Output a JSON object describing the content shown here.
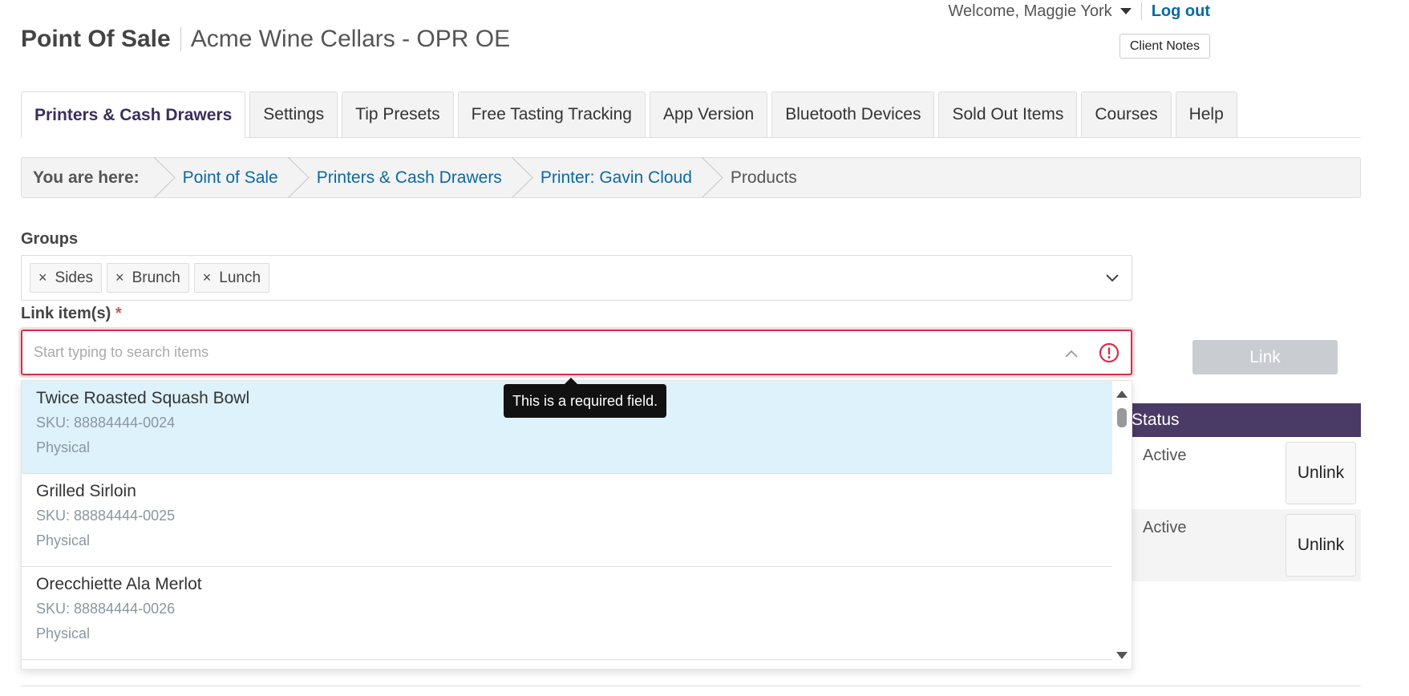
{
  "topbar": {
    "welcome": "Welcome, Maggie York",
    "logout": "Log out",
    "client_notes": "Client Notes"
  },
  "header": {
    "app_title": "Point Of Sale",
    "company": "Acme Wine Cellars - OPR OE"
  },
  "tabs": [
    {
      "label": "Printers & Cash Drawers",
      "active": true
    },
    {
      "label": "Settings"
    },
    {
      "label": "Tip Presets"
    },
    {
      "label": "Free Tasting Tracking"
    },
    {
      "label": "App Version"
    },
    {
      "label": "Bluetooth Devices"
    },
    {
      "label": "Sold Out Items"
    },
    {
      "label": "Courses"
    },
    {
      "label": "Help"
    }
  ],
  "breadcrumb": {
    "label": "You are here:",
    "items": [
      "Point of Sale",
      "Printers & Cash Drawers",
      "Printer: Gavin Cloud"
    ],
    "current": "Products"
  },
  "groups": {
    "label": "Groups",
    "chips": [
      "Sides",
      "Brunch",
      "Lunch"
    ]
  },
  "link_items": {
    "label": "Link item(s)",
    "required_mark": "*",
    "placeholder": "Start typing to search items",
    "value": "",
    "error_tooltip": "This is a required field.",
    "link_button": "Link"
  },
  "dropdown": {
    "items": [
      {
        "name": "Twice Roasted Squash Bowl",
        "sku": "SKU: 88884444-0024",
        "type": "Physical"
      },
      {
        "name": "Grilled Sirloin",
        "sku": "SKU: 88884444-0025",
        "type": "Physical"
      },
      {
        "name": "Orecchiette Ala Merlot",
        "sku": "SKU: 88884444-0026",
        "type": "Physical"
      }
    ]
  },
  "table": {
    "status_header": "Status",
    "rows": [
      {
        "status": "Active",
        "action": "Unlink"
      },
      {
        "status": "Active",
        "action": "Unlink"
      }
    ]
  },
  "colors": {
    "accent_link": "#0a6aa1",
    "header_purple": "#4a3a66",
    "error_red": "#d32f4a",
    "hover_blue": "#ddf2fb"
  }
}
